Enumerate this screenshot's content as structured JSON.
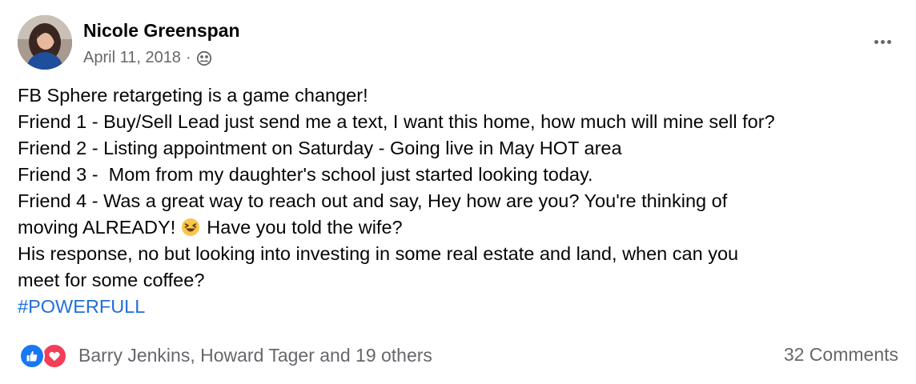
{
  "post": {
    "author": "Nicole Greenspan",
    "date": "April 11, 2018",
    "separator": "·",
    "audience_icon": "friends-icon",
    "lines": {
      "l1": "FB Sphere retargeting is a game changer!",
      "l2": "Friend 1 - Buy/Sell Lead just send me a text, I want this home, how much will mine sell for?",
      "l3": "Friend 2 - Listing appointment on Saturday - Going live in May HOT area",
      "l4": "Friend 3 -  Mom from my daughter's school just started looking today.",
      "l5": "Friend 4 - Was a great way to reach out and say, Hey how are you? You're thinking of",
      "l6a": "moving ALREADY!",
      "l6b": "Have you told the wife?",
      "l7": "His response, no but looking into investing in some real estate and land, when can you",
      "l8": "meet for some coffee?"
    },
    "hashtag": "#POWERFULL"
  },
  "footer": {
    "reactors": "Barry Jenkins, Howard Tager and 19 others",
    "comments": "32 Comments"
  },
  "colors": {
    "link": "#216fdb",
    "like": "#1877f2",
    "love": "#f33e58",
    "secondary_text": "#65676b"
  }
}
